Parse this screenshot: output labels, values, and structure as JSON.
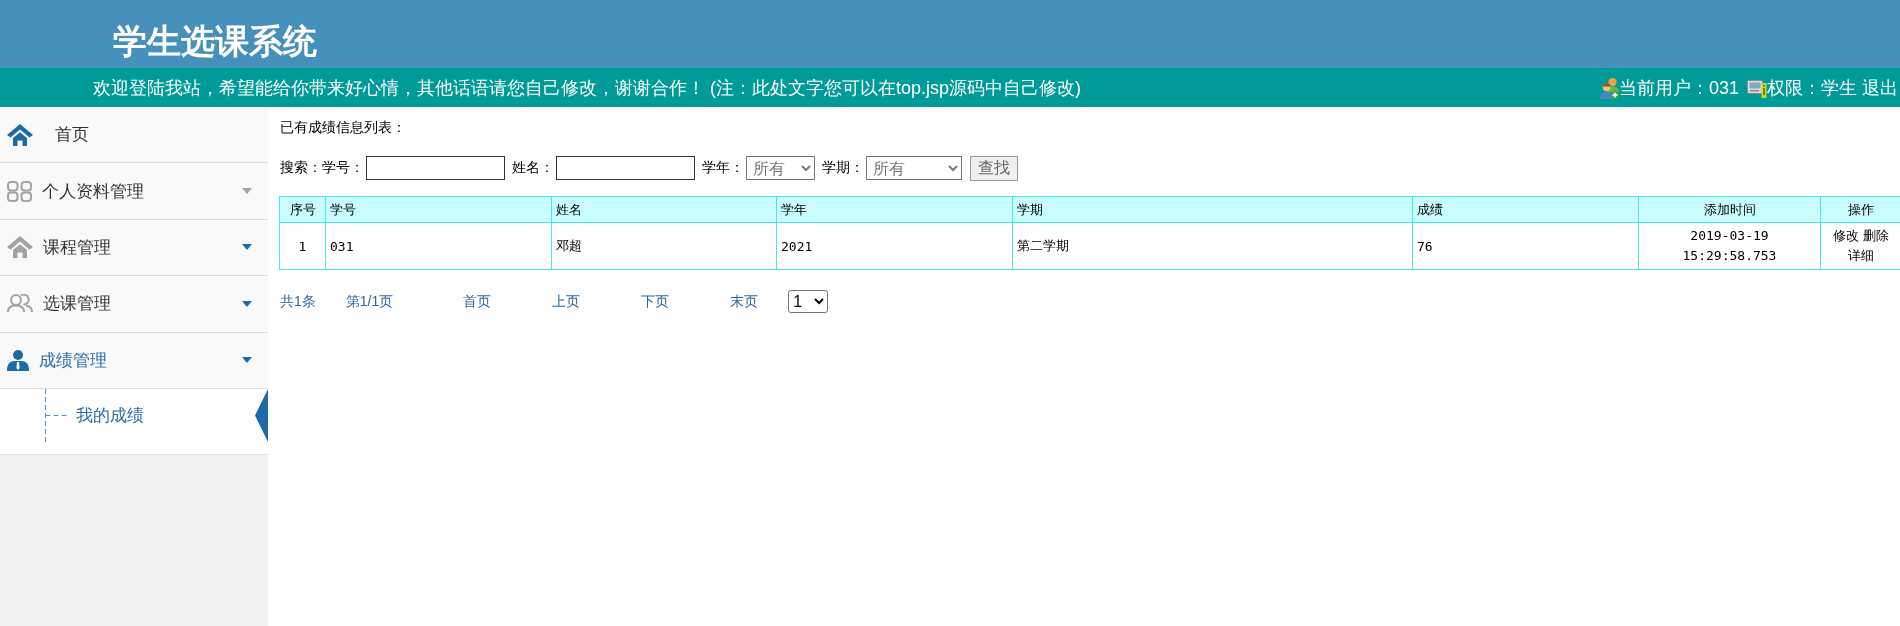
{
  "header": {
    "title": "学生选课系统",
    "welcome": "欢迎登陆我站，希望能给你带来好心情，其他话语请您自己修改，谢谢合作！ (注：此处文字您可以在top.jsp源码中自己修改)",
    "user": "当前用户：031",
    "role": "权限：学生",
    "logout": "退出"
  },
  "sidebar": {
    "items": [
      {
        "kind": "home",
        "label": "首页",
        "expanded": false
      },
      {
        "kind": "profile",
        "label": "个人资料管理",
        "expanded": false
      },
      {
        "kind": "courses",
        "label": "课程管理",
        "expanded": false
      },
      {
        "kind": "enrollment",
        "label": "选课管理",
        "expanded": false
      },
      {
        "kind": "grades",
        "label": "成绩管理",
        "expanded": true,
        "children": [
          {
            "label": "我的成绩",
            "selected": true
          }
        ]
      }
    ]
  },
  "content": {
    "heading": "已有成绩信息列表：",
    "search": {
      "label": "搜索：",
      "fields": [
        {
          "kind": "text",
          "label": "学号："
        },
        {
          "kind": "text",
          "label": "姓名："
        },
        {
          "kind": "select",
          "label": "学年：",
          "value": "所有"
        },
        {
          "kind": "select",
          "label": "学期：",
          "value": "所有"
        }
      ],
      "button": "查找"
    },
    "table": {
      "columns": [
        "序号",
        "学号",
        "姓名",
        "学年",
        "学期",
        "成绩",
        "添加时间",
        "操作"
      ],
      "rows": [
        {
          "cells": [
            "1",
            "031",
            "邓超",
            "2021",
            "第二学期",
            "76",
            "2019-03-19 15:29:58.753"
          ],
          "actions": [
            "修改",
            "删除",
            "详细"
          ]
        }
      ]
    },
    "pagination": {
      "total": "共1条",
      "page": "第1/1页",
      "links": [
        "首页",
        "上页",
        "下页",
        "末页"
      ],
      "page_select": "1"
    }
  }
}
